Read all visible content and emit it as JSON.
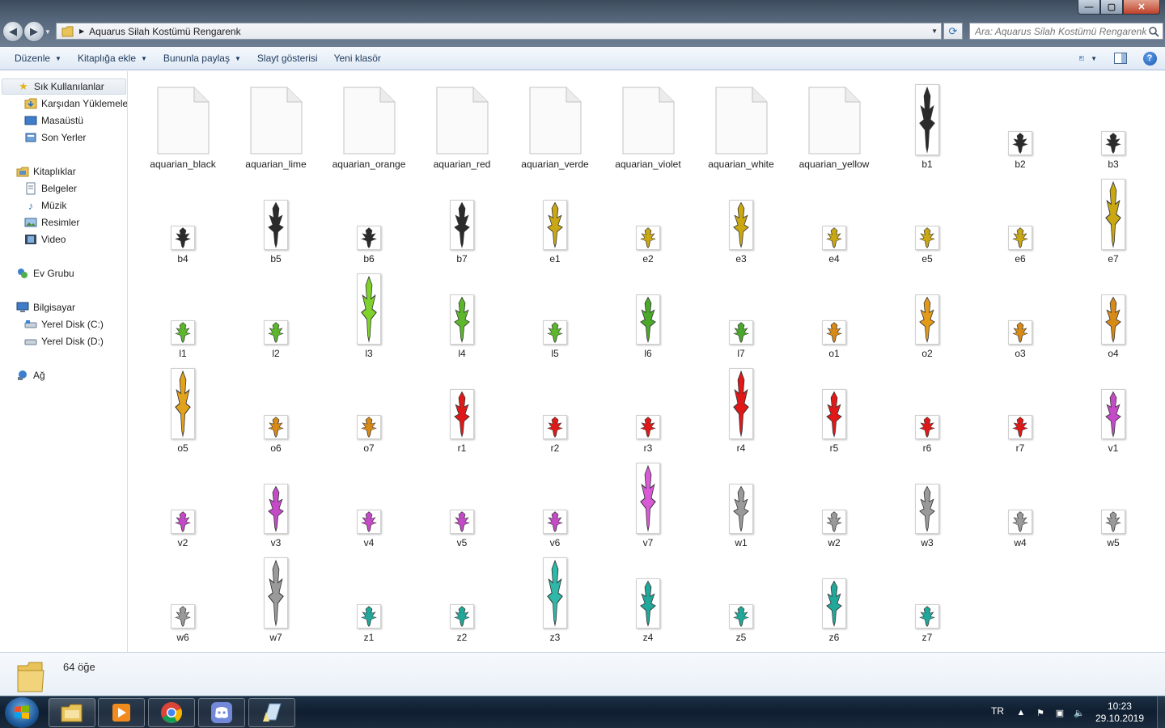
{
  "window": {
    "address": "Aquarus Silah Kostümü Rengarenk",
    "search_placeholder": "Ara: Aquarus Silah Kostümü Rengarenk",
    "controls": {
      "minimize": "—",
      "maximize": "▢",
      "close": "✕"
    }
  },
  "toolbar": {
    "organize": "Düzenle",
    "include_library": "Kitaplığa ekle",
    "share_with": "Bununla paylaş",
    "slideshow": "Slayt gösterisi",
    "new_folder": "Yeni klasör"
  },
  "nav": {
    "favorites": "Sık Kullanılanlar",
    "downloads": "Karşıdan Yüklemeler",
    "desktop": "Masaüstü",
    "recent": "Son Yerler",
    "libraries": "Kitaplıklar",
    "documents": "Belgeler",
    "music": "Müzik",
    "pictures": "Resimler",
    "videos": "Video",
    "homegroup": "Ev Grubu",
    "computer": "Bilgisayar",
    "disk_c": "Yerel Disk (C:)",
    "disk_d": "Yerel Disk (D:)",
    "network": "Ağ"
  },
  "files": [
    {
      "name": "aquarian_black",
      "kind": "doc"
    },
    {
      "name": "aquarian_lime",
      "kind": "doc"
    },
    {
      "name": "aquarian_orange",
      "kind": "doc"
    },
    {
      "name": "aquarian_red",
      "kind": "doc"
    },
    {
      "name": "aquarian_verde",
      "kind": "doc"
    },
    {
      "name": "aquarian_violet",
      "kind": "doc"
    },
    {
      "name": "aquarian_white",
      "kind": "doc"
    },
    {
      "name": "aquarian_yellow",
      "kind": "doc"
    },
    {
      "name": "b1",
      "kind": "weapon",
      "color": "#2b2b2b"
    },
    {
      "name": "b2",
      "kind": "weapon",
      "color": "#2b2b2b"
    },
    {
      "name": "b3",
      "kind": "weapon",
      "color": "#2b2b2b"
    },
    {
      "name": "b4",
      "kind": "weapon",
      "color": "#2b2b2b"
    },
    {
      "name": "b5",
      "kind": "weapon",
      "color": "#2b2b2b"
    },
    {
      "name": "b6",
      "kind": "weapon",
      "color": "#2b2b2b"
    },
    {
      "name": "b7",
      "kind": "weapon",
      "color": "#2b2b2b"
    },
    {
      "name": "e1",
      "kind": "weapon",
      "color": "#c9a814"
    },
    {
      "name": "e2",
      "kind": "weapon",
      "color": "#c9a814"
    },
    {
      "name": "e3",
      "kind": "weapon",
      "color": "#c9a814"
    },
    {
      "name": "e4",
      "kind": "weapon",
      "color": "#c9a814"
    },
    {
      "name": "e5",
      "kind": "weapon",
      "color": "#c9a814"
    },
    {
      "name": "e6",
      "kind": "weapon",
      "color": "#c9a814"
    },
    {
      "name": "e7",
      "kind": "weapon",
      "color": "#c9a814"
    },
    {
      "name": "l1",
      "kind": "weapon",
      "color": "#5cb82a"
    },
    {
      "name": "l2",
      "kind": "weapon",
      "color": "#5cb82a"
    },
    {
      "name": "l3",
      "kind": "weapon",
      "color": "#7fd22c"
    },
    {
      "name": "l4",
      "kind": "weapon",
      "color": "#5cb82a"
    },
    {
      "name": "l5",
      "kind": "weapon",
      "color": "#5cb82a"
    },
    {
      "name": "l6",
      "kind": "weapon",
      "color": "#4aa82a"
    },
    {
      "name": "l7",
      "kind": "weapon",
      "color": "#4aa82a"
    },
    {
      "name": "o1",
      "kind": "weapon",
      "color": "#d88a16"
    },
    {
      "name": "o2",
      "kind": "weapon",
      "color": "#e39a18"
    },
    {
      "name": "o3",
      "kind": "weapon",
      "color": "#d88a16"
    },
    {
      "name": "o4",
      "kind": "weapon",
      "color": "#d88a16"
    },
    {
      "name": "o5",
      "kind": "weapon",
      "color": "#e3a21c"
    },
    {
      "name": "o6",
      "kind": "weapon",
      "color": "#d88a16"
    },
    {
      "name": "o7",
      "kind": "weapon",
      "color": "#d88a16"
    },
    {
      "name": "r1",
      "kind": "weapon",
      "color": "#e01818"
    },
    {
      "name": "r2",
      "kind": "weapon",
      "color": "#e01818"
    },
    {
      "name": "r3",
      "kind": "weapon",
      "color": "#e01818"
    },
    {
      "name": "r4",
      "kind": "weapon",
      "color": "#e01818"
    },
    {
      "name": "r5",
      "kind": "weapon",
      "color": "#e01818"
    },
    {
      "name": "r6",
      "kind": "weapon",
      "color": "#e01818"
    },
    {
      "name": "r7",
      "kind": "weapon",
      "color": "#e01818"
    },
    {
      "name": "v1",
      "kind": "weapon",
      "color": "#c54ac8"
    },
    {
      "name": "v2",
      "kind": "weapon",
      "color": "#c54ac8"
    },
    {
      "name": "v3",
      "kind": "weapon",
      "color": "#c54ac8"
    },
    {
      "name": "v4",
      "kind": "weapon",
      "color": "#c54ac8"
    },
    {
      "name": "v5",
      "kind": "weapon",
      "color": "#c54ac8"
    },
    {
      "name": "v6",
      "kind": "weapon",
      "color": "#c54ac8"
    },
    {
      "name": "v7",
      "kind": "weapon",
      "color": "#d95ad6"
    },
    {
      "name": "w1",
      "kind": "weapon",
      "color": "#9a9a9a"
    },
    {
      "name": "w2",
      "kind": "weapon",
      "color": "#9a9a9a"
    },
    {
      "name": "w3",
      "kind": "weapon",
      "color": "#9a9a9a"
    },
    {
      "name": "w4",
      "kind": "weapon",
      "color": "#9a9a9a"
    },
    {
      "name": "w5",
      "kind": "weapon",
      "color": "#9a9a9a"
    },
    {
      "name": "w6",
      "kind": "weapon",
      "color": "#9a9a9a"
    },
    {
      "name": "w7",
      "kind": "weapon",
      "color": "#9a9a9a"
    },
    {
      "name": "z1",
      "kind": "weapon",
      "color": "#21a89a"
    },
    {
      "name": "z2",
      "kind": "weapon",
      "color": "#21a89a"
    },
    {
      "name": "z3",
      "kind": "weapon",
      "color": "#2fb8a8"
    },
    {
      "name": "z4",
      "kind": "weapon",
      "color": "#21a89a"
    },
    {
      "name": "z5",
      "kind": "weapon",
      "color": "#21a89a"
    },
    {
      "name": "z6",
      "kind": "weapon",
      "color": "#21a89a"
    },
    {
      "name": "z7",
      "kind": "weapon",
      "color": "#21a89a"
    }
  ],
  "status": {
    "count": "64 öğe"
  },
  "taskbar": {
    "items": [
      "file-explorer",
      "media-player",
      "chrome",
      "discord",
      "notes-app"
    ],
    "lang": "TR",
    "time": "10:23",
    "date": "29.10.2019"
  },
  "colors": {
    "accent": "#1e395b",
    "taskbar": "#0f1e30",
    "selection": "#e3e9f0"
  }
}
